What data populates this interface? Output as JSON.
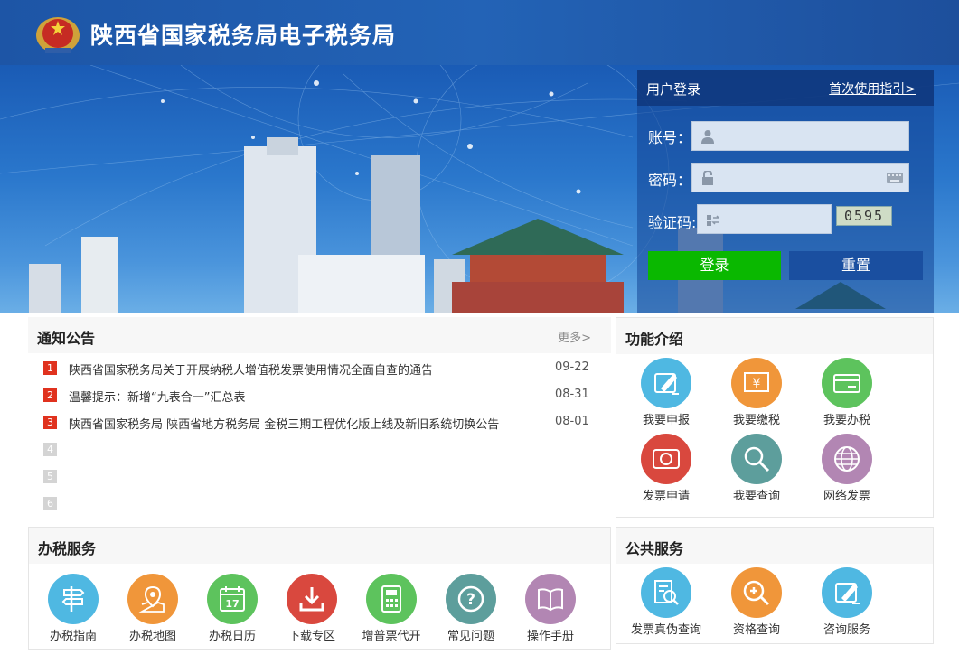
{
  "header": {
    "title": "陕西省国家税务局电子税务局"
  },
  "login": {
    "title": "用户登录",
    "guide_link": "首次使用指引>",
    "account_label": "账号：",
    "password_label": "密码：",
    "captcha_label": "验证码:",
    "account_value": "",
    "password_value": "",
    "captcha_value": "",
    "captcha_code": "0595",
    "login_button": "登录",
    "reset_button": "重置"
  },
  "notices": {
    "title": "通知公告",
    "more": "更多>",
    "items": [
      {
        "num": "1",
        "text": "陕西省国家税务局关于开展纳税人增值税发票使用情况全面自查的通告",
        "date": "09-22"
      },
      {
        "num": "2",
        "text": "温馨提示：新增“九表合一”汇总表",
        "date": "08-31"
      },
      {
        "num": "3",
        "text": "陕西省国家税务局 陕西省地方税务局 金税三期工程优化版上线及新旧系统切换公告",
        "date": "08-01"
      },
      {
        "num": "4",
        "text": "",
        "date": ""
      },
      {
        "num": "5",
        "text": "",
        "date": ""
      },
      {
        "num": "6",
        "text": "",
        "date": ""
      }
    ]
  },
  "features": {
    "title": "功能介绍",
    "items": [
      {
        "label": "我要申报",
        "icon": "pen-icon",
        "color": "#4fb8e2"
      },
      {
        "label": "我要缴税",
        "icon": "yuan-icon",
        "color": "#f0963a"
      },
      {
        "label": "我要办税",
        "icon": "card-icon",
        "color": "#5dc35d"
      },
      {
        "label": "发票申请",
        "icon": "invoice-icon",
        "color": "#d9483e"
      },
      {
        "label": "我要查询",
        "icon": "magnifier-icon",
        "color": "#5d9e9c"
      },
      {
        "label": "网络发票",
        "icon": "globe-icon",
        "color": "#b286b3"
      }
    ]
  },
  "tax_services": {
    "title": "办税服务",
    "items": [
      {
        "label": "办税指南",
        "icon": "signpost-icon",
        "color": "#4fb8e2"
      },
      {
        "label": "办税地图",
        "icon": "map-icon",
        "color": "#f0963a"
      },
      {
        "label": "办税日历",
        "icon": "calendar-icon",
        "color": "#5dc35d"
      },
      {
        "label": "下载专区",
        "icon": "download-icon",
        "color": "#d9483e"
      },
      {
        "label": "增普票代开",
        "icon": "calculator-icon",
        "color": "#5dc35d"
      },
      {
        "label": "常见问题",
        "icon": "question-icon",
        "color": "#5d9e9c"
      },
      {
        "label": "操作手册",
        "icon": "book-icon",
        "color": "#b286b3"
      }
    ]
  },
  "public_services": {
    "title": "公共服务",
    "items": [
      {
        "label": "发票真伪查询",
        "icon": "invoice-check-icon",
        "color": "#4fb8e2"
      },
      {
        "label": "资格查询",
        "icon": "search-plus-icon",
        "color": "#f0963a"
      },
      {
        "label": "咨询服务",
        "icon": "pen-icon",
        "color": "#4fb8e2"
      }
    ]
  }
}
